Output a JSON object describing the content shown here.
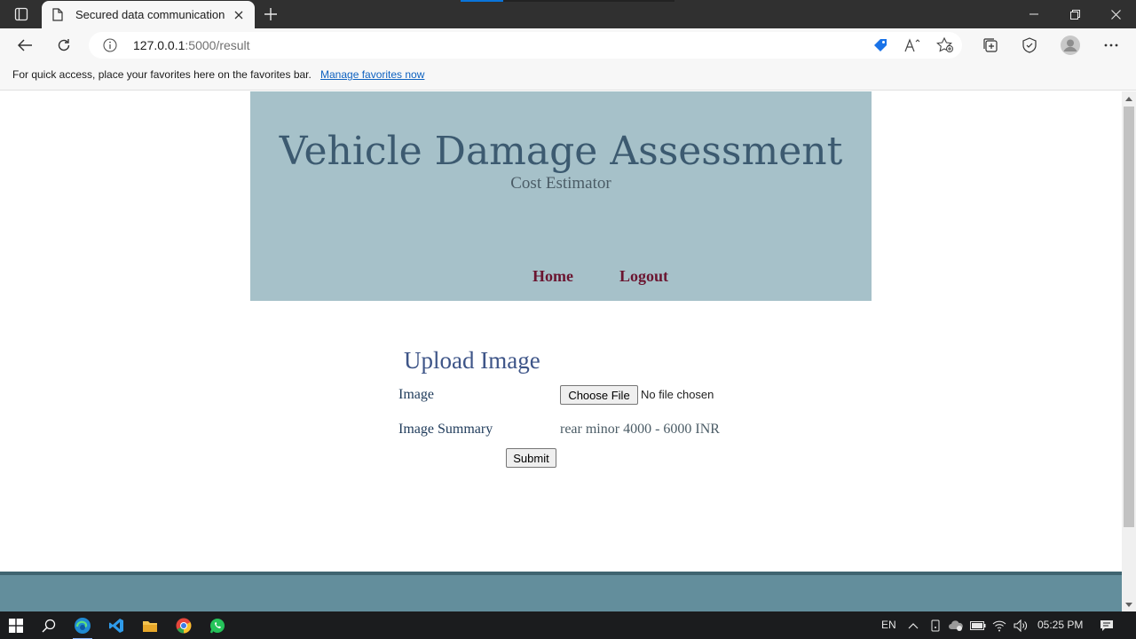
{
  "browser": {
    "tab_title": "Secured data communication",
    "url_host": "127.0.0.1",
    "url_path": ":5000/result"
  },
  "favorites_bar": {
    "text": "For quick access, place your favorites here on the favorites bar.",
    "link": "Manage favorites now"
  },
  "site": {
    "title": "Vehicle Damage Assessment",
    "subtitle": "Cost Estimator",
    "nav": [
      "Home",
      "Logout"
    ]
  },
  "form": {
    "title": "Upload Image",
    "image_label": "Image",
    "choose_file_label": "Choose File",
    "file_status": "No file chosen",
    "summary_label": "Image Summary",
    "summary_value": "rear minor 4000 - 6000 INR",
    "submit_label": "Submit"
  },
  "taskbar": {
    "language": "EN",
    "time": "05:25 PM"
  },
  "colors": {
    "header_bg": "#a6c1c9",
    "footer_bg": "#638e9c",
    "title_color": "#3c5a70",
    "nav_color": "#6b1530"
  }
}
